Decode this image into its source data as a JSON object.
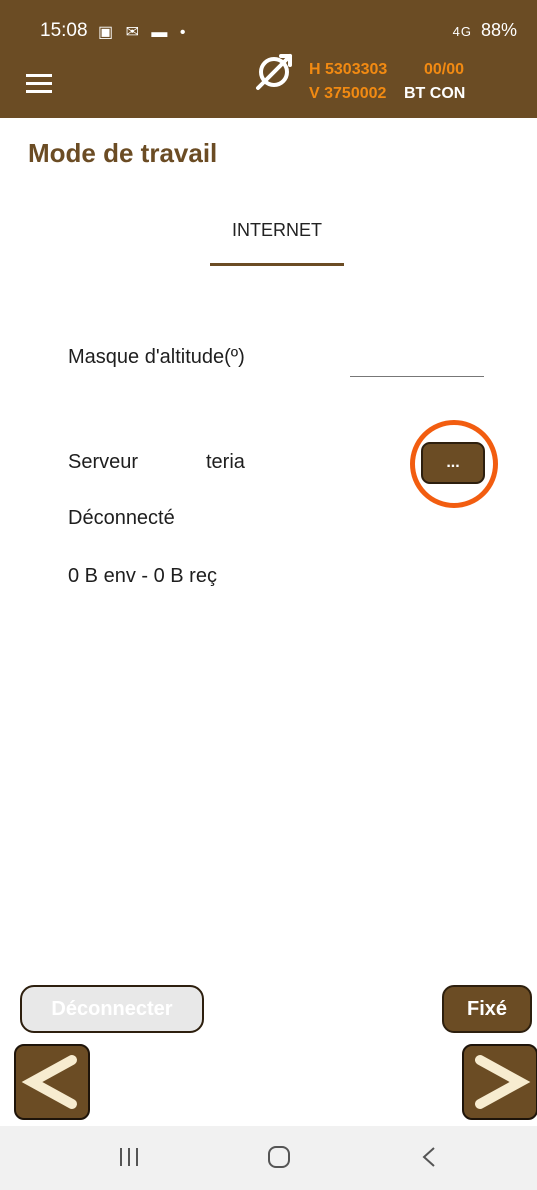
{
  "status_bar": {
    "time": "15:08",
    "left_icons": "▣ ✉ ▬ •",
    "signal": "4G",
    "battery": "88%"
  },
  "header": {
    "menu_icon": "hamburger-menu-icon",
    "gps_icon": "no-fix-crosshair-icon",
    "coord_h": "H 5303303",
    "coord_v": "V 3750002",
    "fix_counter": "00/00",
    "bt_status": "BT CON",
    "colors": {
      "bar": "#6b4c24",
      "accent": "#f28a12"
    }
  },
  "page": {
    "title": "Mode de travail",
    "tab_label": "INTERNET"
  },
  "form": {
    "altitude_mask_label": "Masque d'altitude(º)",
    "altitude_mask_value": "",
    "server_label": "Serveur",
    "server_value": "teria",
    "more_button_label": "...",
    "connection_status": "Déconnecté",
    "traffic": "0 B env - 0 B reç"
  },
  "actions": {
    "disconnect_label": "Déconnecter",
    "fix_label": "Fixé",
    "prev_icon": "chevron-left-icon",
    "next_icon": "chevron-right-icon"
  },
  "system_nav": {
    "recents_icon": "recents-icon",
    "home_icon": "home-icon",
    "back_icon": "back-icon"
  }
}
